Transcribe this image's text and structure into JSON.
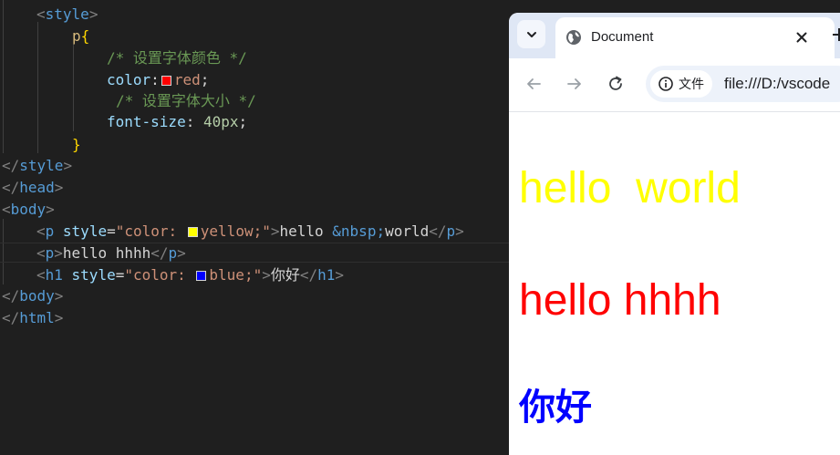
{
  "editor": {
    "lines": [
      {
        "key": "style_open",
        "parts": [
          {
            "t": "<",
            "c": "br"
          },
          {
            "t": "style",
            "c": "tag"
          },
          {
            "t": ">",
            "c": "br"
          }
        ]
      },
      {
        "key": "p_sel",
        "parts": [
          {
            "t": "p",
            "c": "sel"
          },
          {
            "t": "{",
            "c": "brace"
          }
        ]
      },
      {
        "key": "cmt_color",
        "parts": [
          {
            "t": "/* 设置字体颜色 */",
            "c": "cmt"
          }
        ]
      },
      {
        "key": "color_prop",
        "parts": [
          {
            "t": "color",
            "c": "attr"
          },
          {
            "t": ":",
            "c": "txt"
          },
          {
            "swatch": "#ff0000"
          },
          {
            "t": "red",
            "c": "str"
          },
          {
            "t": ";",
            "c": "txt"
          }
        ]
      },
      {
        "key": "cmt_size",
        "parts": [
          {
            "t": "/* 设置字体大小 */",
            "c": "cmt"
          }
        ]
      },
      {
        "key": "size_prop",
        "parts": [
          {
            "t": "font-size",
            "c": "attr"
          },
          {
            "t": ": ",
            "c": "txt"
          },
          {
            "t": "40px",
            "c": "num"
          },
          {
            "t": ";",
            "c": "txt"
          }
        ]
      },
      {
        "key": "brace_close",
        "parts": [
          {
            "t": "}",
            "c": "brace"
          }
        ]
      },
      {
        "key": "style_close",
        "parts": [
          {
            "t": "</",
            "c": "br"
          },
          {
            "t": "style",
            "c": "tag"
          },
          {
            "t": ">",
            "c": "br"
          }
        ]
      },
      {
        "key": "head_close",
        "parts": [
          {
            "t": "</",
            "c": "br"
          },
          {
            "t": "head",
            "c": "tag"
          },
          {
            "t": ">",
            "c": "br"
          }
        ]
      },
      {
        "key": "body_open",
        "parts": [
          {
            "t": "<",
            "c": "br"
          },
          {
            "t": "body",
            "c": "tag"
          },
          {
            "t": ">",
            "c": "br"
          }
        ]
      },
      {
        "key": "p_yellow",
        "parts": [
          {
            "t": "<",
            "c": "br"
          },
          {
            "t": "p",
            "c": "tag"
          },
          {
            "t": " style",
            "c": "attr"
          },
          {
            "t": "=",
            "c": "txt"
          },
          {
            "t": "\"color: ",
            "c": "str"
          },
          {
            "swatch": "#ffff00"
          },
          {
            "t": "yellow;\"",
            "c": "str"
          },
          {
            "t": ">",
            "c": "br"
          },
          {
            "t": "hello ",
            "c": "txt"
          },
          {
            "t": "&nbsp;",
            "c": "ent"
          },
          {
            "t": "world",
            "c": "txt"
          },
          {
            "t": "</",
            "c": "br"
          },
          {
            "t": "p",
            "c": "tag"
          },
          {
            "t": ">",
            "c": "br"
          }
        ]
      },
      {
        "key": "p_hhhh",
        "parts": [
          {
            "t": "<",
            "c": "br"
          },
          {
            "t": "p",
            "c": "tag"
          },
          {
            "t": ">",
            "c": "br"
          },
          {
            "t": "hello hhhh",
            "c": "txt"
          },
          {
            "t": "</",
            "c": "br"
          },
          {
            "t": "p",
            "c": "tag"
          },
          {
            "t": ">",
            "c": "br"
          }
        ]
      },
      {
        "key": "h1_blue",
        "parts": [
          {
            "t": "<",
            "c": "br"
          },
          {
            "t": "h1",
            "c": "tag"
          },
          {
            "t": " style",
            "c": "attr"
          },
          {
            "t": "=",
            "c": "txt"
          },
          {
            "t": "\"color: ",
            "c": "str"
          },
          {
            "swatch": "#0000ff"
          },
          {
            "t": "blue;\"",
            "c": "str"
          },
          {
            "t": ">",
            "c": "br"
          },
          {
            "t": "你好",
            "c": "txt"
          },
          {
            "t": "</",
            "c": "br"
          },
          {
            "t": "h1",
            "c": "tag"
          },
          {
            "t": ">",
            "c": "br"
          }
        ]
      },
      {
        "key": "body_close",
        "parts": [
          {
            "t": "</",
            "c": "br"
          },
          {
            "t": "body",
            "c": "tag"
          },
          {
            "t": ">",
            "c": "br"
          }
        ]
      },
      {
        "key": "html_close",
        "parts": [
          {
            "t": "</",
            "c": "br"
          },
          {
            "t": "html",
            "c": "tag"
          },
          {
            "t": ">",
            "c": "br"
          }
        ]
      }
    ]
  },
  "browser": {
    "tab_title": "Document",
    "chip_label": "文件",
    "url": "file:///D:/vscode",
    "icons": {
      "tab_search": "chevron-down-icon",
      "favicon": "globe-icon",
      "close": "close-icon",
      "back": "back-arrow-icon",
      "forward": "forward-arrow-icon",
      "reload": "reload-icon",
      "info": "info-icon"
    }
  },
  "page": {
    "p1": "hello  world",
    "p2": "hello hhhh",
    "h1": "你好"
  },
  "colors": {
    "editor_bg": "#1f1f1f",
    "tabstrip_bg": "#dfe7f5",
    "omnibox_bg": "#edf2fa",
    "p1_color": "#ffff00",
    "p2_color": "#ff0000",
    "h1_color": "#0000ff"
  }
}
